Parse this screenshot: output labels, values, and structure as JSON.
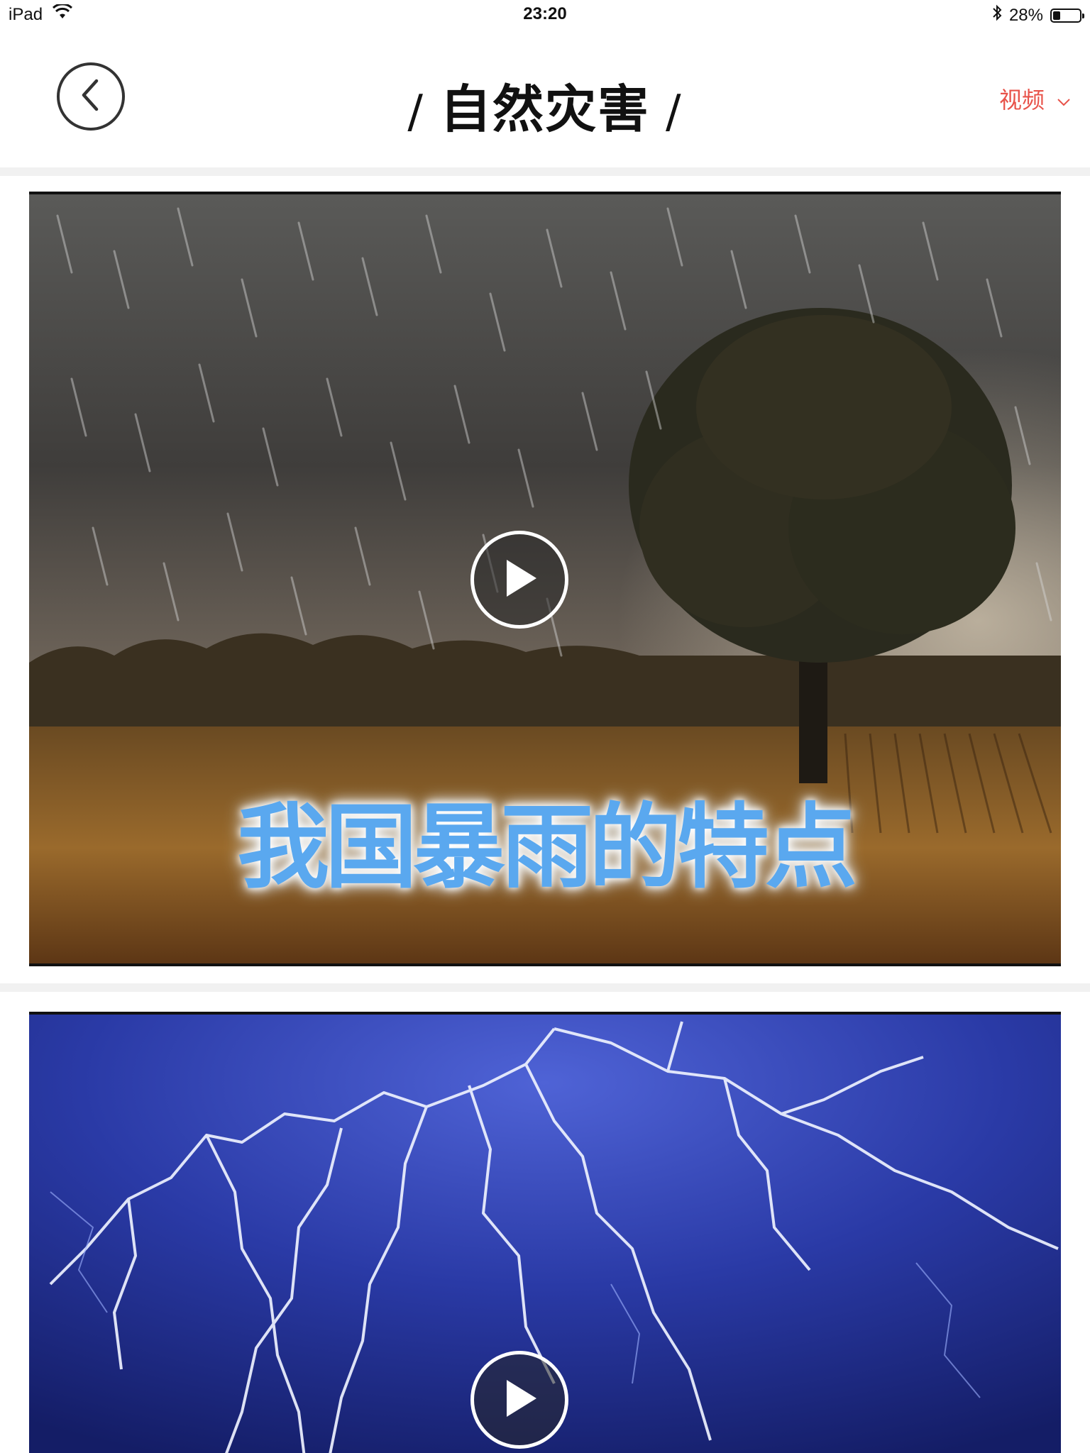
{
  "status_bar": {
    "device": "iPad",
    "time": "23:20",
    "battery": "28%",
    "battery_level": 0.28,
    "icons": [
      "wifi-icon",
      "bluetooth-icon",
      "battery-icon"
    ]
  },
  "header": {
    "title": "自然灾害",
    "title_left_decor": "/",
    "title_right_decor": "/",
    "back_icon": "chevron-left-icon",
    "filter_label": "视频",
    "filter_icon": "chevron-down-icon"
  },
  "colors": {
    "accent": "#e8534a",
    "caption_text": "#5aa8ef",
    "background": "#f1f1f1"
  },
  "videos": [
    {
      "caption": "我国暴雨的特点",
      "scene": "rainstorm-tree-field",
      "play_icon": "play-icon"
    },
    {
      "caption": "",
      "scene": "lightning-storm",
      "play_icon": "play-icon"
    }
  ]
}
